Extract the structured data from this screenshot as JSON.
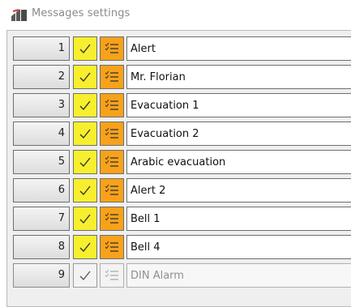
{
  "window": {
    "title": "Messages settings",
    "icon": "speaker-settings-icon"
  },
  "colors": {
    "check_active": "#f7ef2e",
    "list_active": "#f7a21a",
    "disabled_bg": "#f3f3f3"
  },
  "messages": [
    {
      "number": "1",
      "name": "Alert",
      "enabled": true
    },
    {
      "number": "2",
      "name": "Mr. Florian",
      "enabled": true
    },
    {
      "number": "3",
      "name": "Evacuation 1",
      "enabled": true
    },
    {
      "number": "4",
      "name": "Evacuation 2",
      "enabled": true
    },
    {
      "number": "5",
      "name": "Arabic evacuation",
      "enabled": true
    },
    {
      "number": "6",
      "name": "Alert 2",
      "enabled": true
    },
    {
      "number": "7",
      "name": "Bell 1",
      "enabled": true
    },
    {
      "number": "8",
      "name": "Bell 4",
      "enabled": true
    },
    {
      "number": "9",
      "name": "DIN Alarm",
      "enabled": false
    }
  ]
}
